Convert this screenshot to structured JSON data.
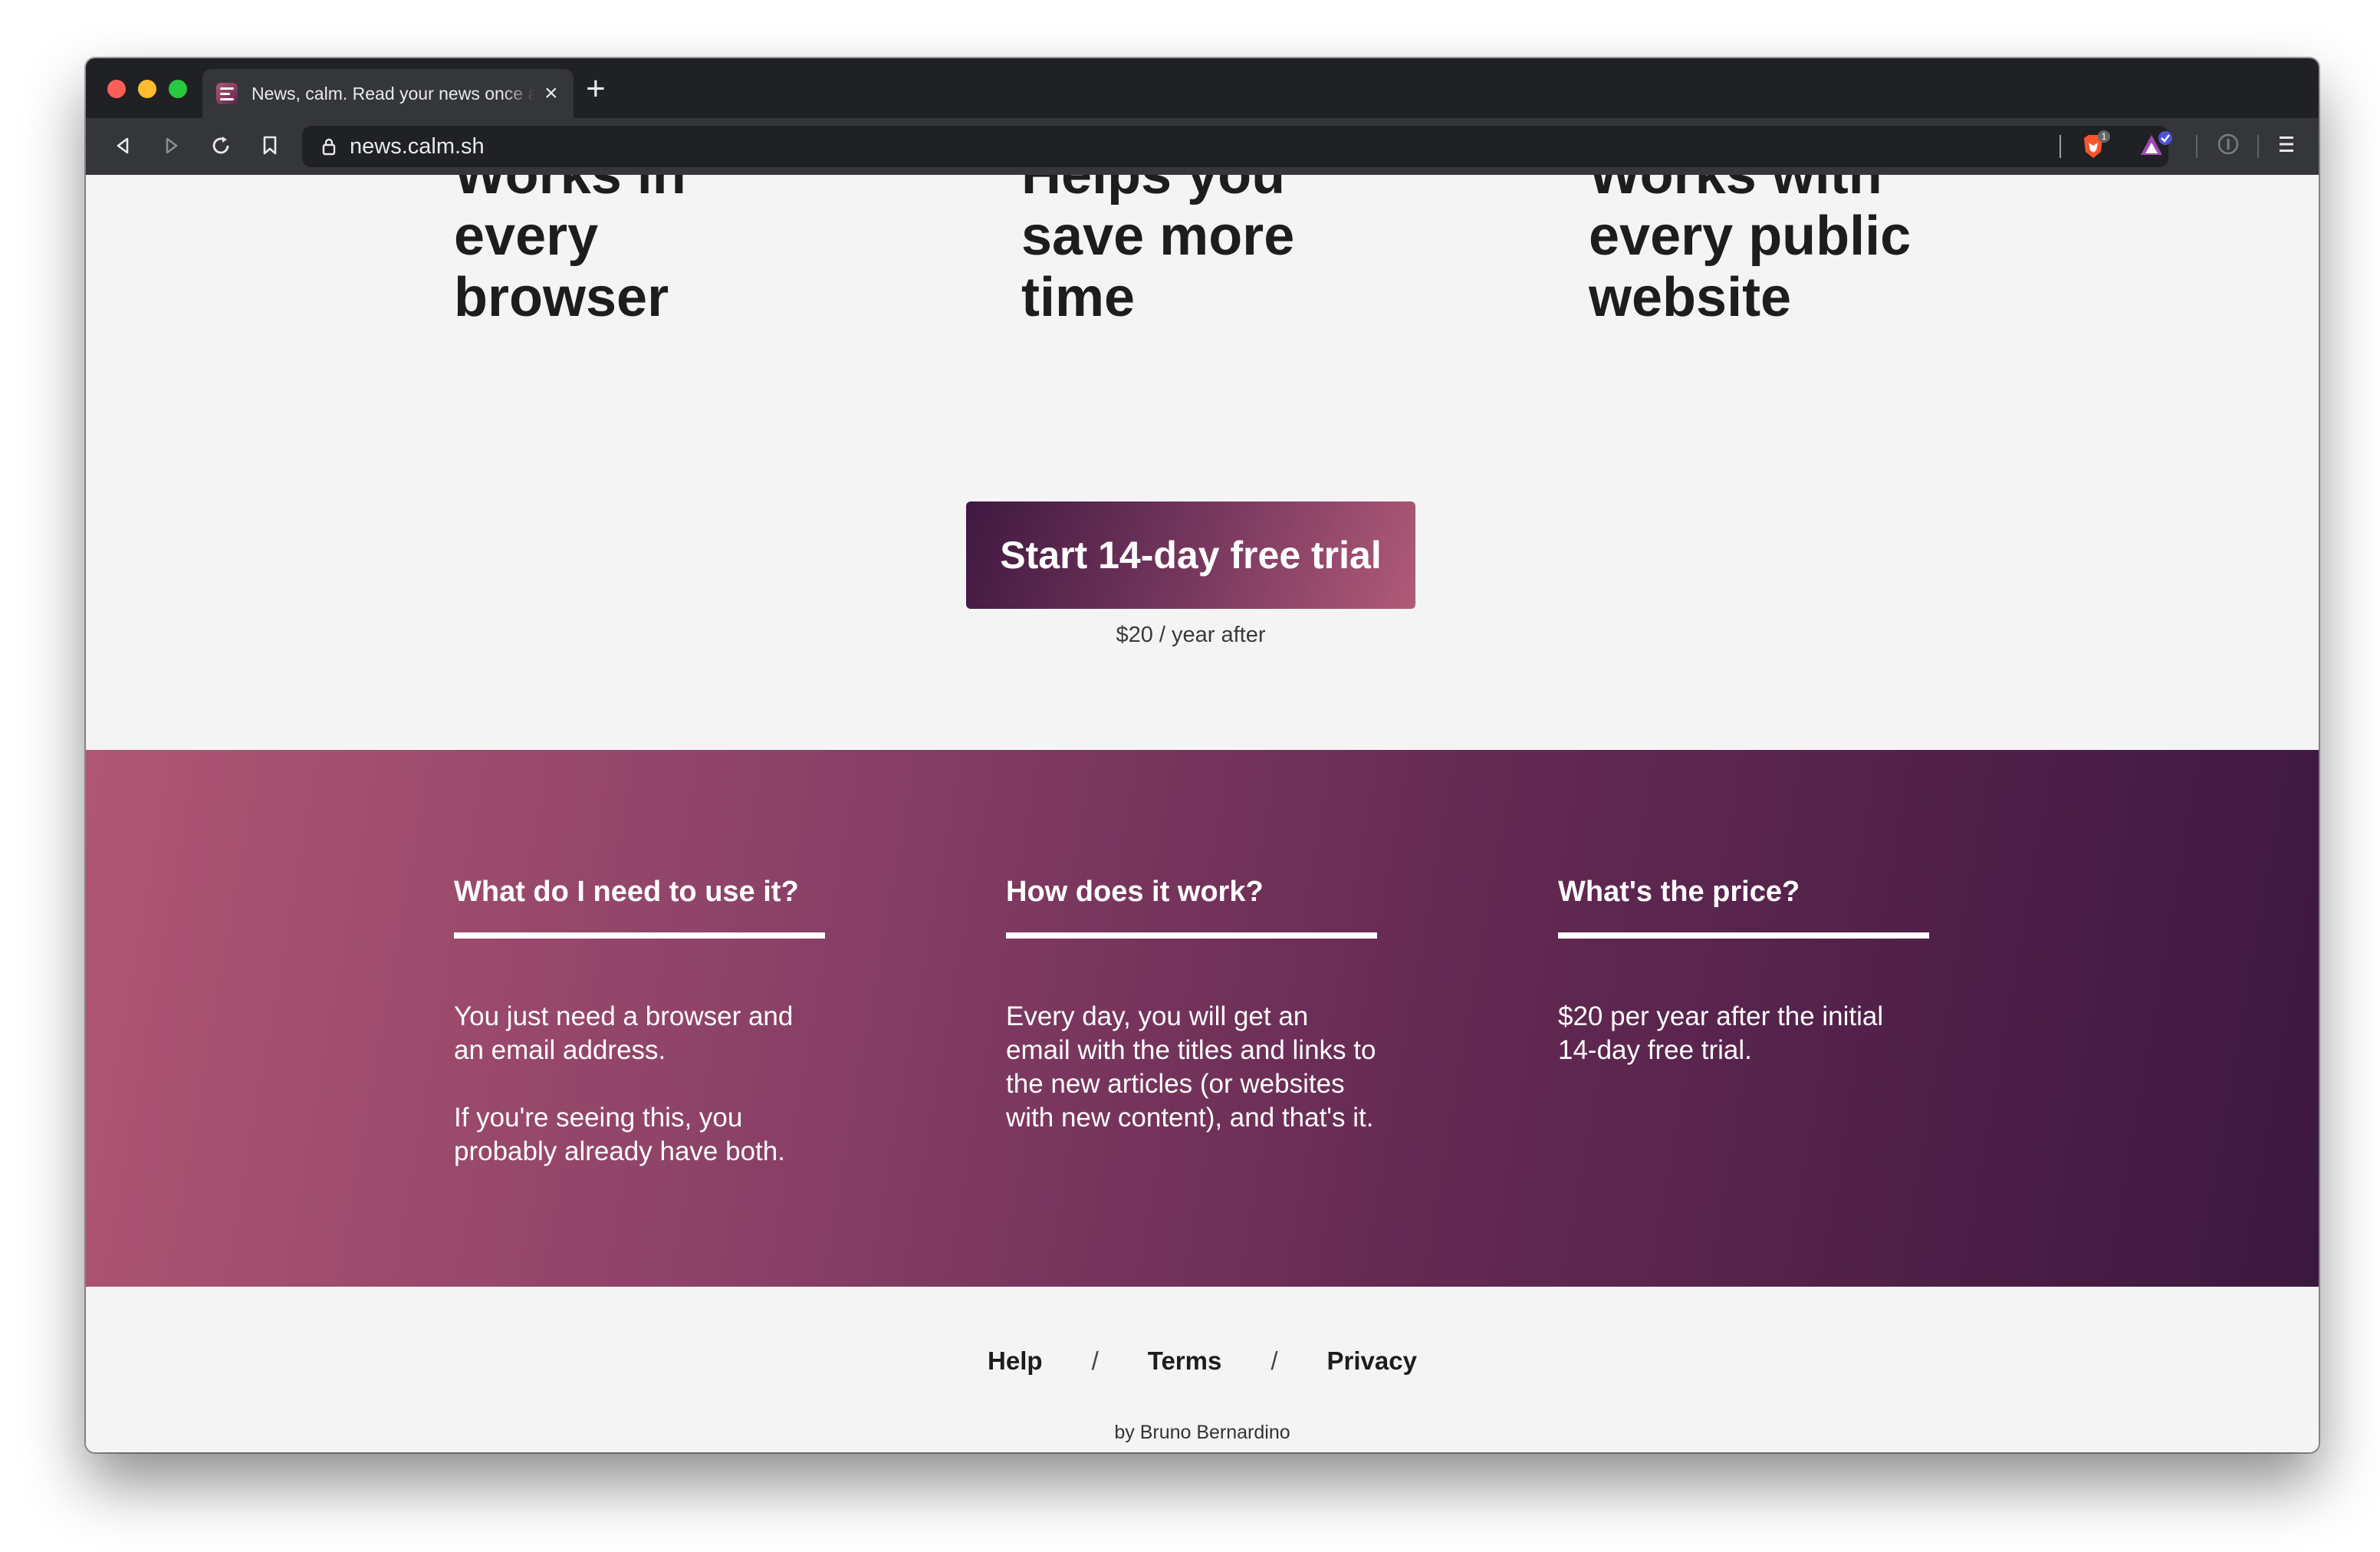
{
  "browser": {
    "tab_title": "News, calm. Read your news once a day",
    "url": "news.calm.sh",
    "shields_count": "1"
  },
  "features": [
    {
      "line1": "Works in",
      "line2": "every",
      "line3": "browser"
    },
    {
      "line1": "Helps you",
      "line2": "save more",
      "line3": "time"
    },
    {
      "line1": "Works with",
      "line2": "every public",
      "line3": "website"
    }
  ],
  "cta": {
    "label": "Start 14-day free trial",
    "note": "$20 / year after"
  },
  "faq": [
    {
      "question": "What do I need to use it?",
      "answer1": "You just need a browser and an email address.",
      "answer2": "If you're seeing this, you probably already have both."
    },
    {
      "question": "How does it work?",
      "answer1": "Every day, you will get an email with the titles and links to the new articles (or websites with new content), and that's it."
    },
    {
      "question": "What's the price?",
      "answer1": "$20 per year after the initial 14-day free trial."
    }
  ],
  "footer": {
    "help": "Help",
    "terms": "Terms",
    "privacy": "Privacy",
    "separator": "/",
    "byline": "by Bruno Bernardino"
  },
  "colors": {
    "accent_dark": "#3f1840",
    "accent_light": "#b15a78",
    "page_bg": "#f4f4f4"
  }
}
